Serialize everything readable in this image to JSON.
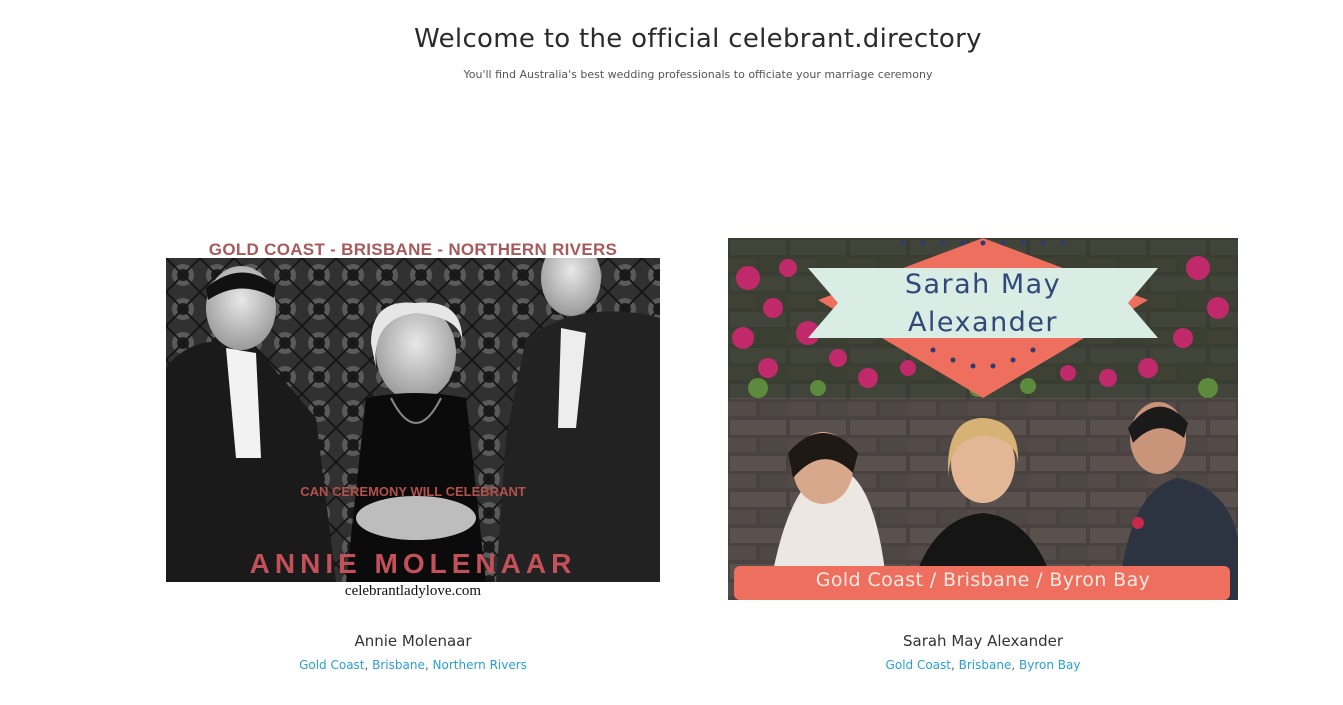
{
  "hero": {
    "title": "Welcome to the official celebrant.directory",
    "subtitle": "You'll find Australia's best wedding professionals to officiate your marriage ceremony"
  },
  "celebrants": [
    {
      "name": "Annie Molenaar",
      "locations": [
        "Gold Coast",
        "Brisbane",
        "Northern Rivers"
      ],
      "image_text": {
        "top": "GOLD COAST  -  BRISBANE  -  NORTHERN RIVERS",
        "middle": "CAN CEREMONY   WILL CELEBRANT",
        "name": "ANNIE MOLENAAR",
        "url": "celebrantladylove.com"
      }
    },
    {
      "name": "Sarah May Alexander",
      "locations": [
        "Gold Coast",
        "Brisbane",
        "Byron Bay"
      ],
      "image_text": {
        "name_line1": "Sarah May",
        "name_line2": "Alexander",
        "banner": "Gold Coast / Brisbane / Byron Bay"
      }
    }
  ],
  "colors": {
    "link": "#2a9fd6",
    "coral": "#ef6f5f",
    "mint": "#d9ede4",
    "navy": "#2f4a7a"
  }
}
